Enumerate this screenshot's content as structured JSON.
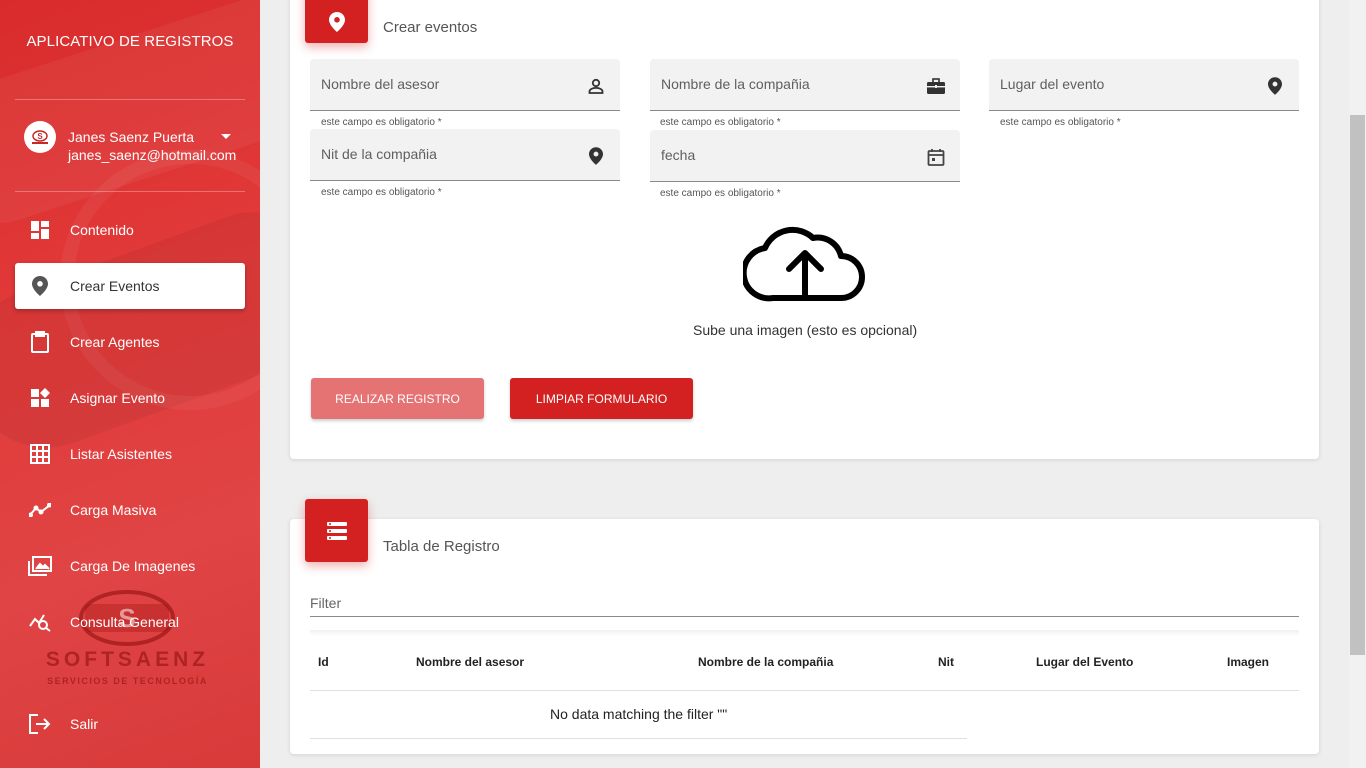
{
  "sidebar": {
    "brand_title": "APLICATIVO DE REGISTROS",
    "user": {
      "name": "Janes Saenz Puerta",
      "email": "janes_saenz@hotmail.com"
    },
    "items": [
      {
        "label": "Contenido",
        "icon": "dashboard-icon"
      },
      {
        "label": "Crear Eventos",
        "icon": "location-pin-icon",
        "active": true
      },
      {
        "label": "Crear Agentes",
        "icon": "clipboard-icon"
      },
      {
        "label": "Asignar Evento",
        "icon": "widgets-icon"
      },
      {
        "label": "Listar Asistentes",
        "icon": "grid-icon"
      },
      {
        "label": "Carga Masiva",
        "icon": "trend-line-icon"
      },
      {
        "label": "Carga De Imagenes",
        "icon": "photo-library-icon"
      },
      {
        "label": "Consulta General",
        "icon": "query-stats-icon"
      },
      {
        "label": "Salir",
        "icon": "logout-icon"
      }
    ],
    "logo": {
      "text": "SOFTSAENZ",
      "subtitle": "SERVICIOS DE TECNOLOGÍA"
    }
  },
  "form_card": {
    "title": "Crear eventos",
    "fields": {
      "asesor": {
        "label": "Nombre del asesor",
        "hint": "este campo es obligatorio *"
      },
      "compania": {
        "label": "Nombre de la compañia",
        "hint": "este campo es obligatorio *"
      },
      "lugar": {
        "label": "Lugar del evento",
        "hint": "este campo es obligatorio *"
      },
      "nit": {
        "label": "Nit de la compañia",
        "hint": "este campo es obligatorio *"
      },
      "fecha": {
        "label": "fecha",
        "hint": "este campo es obligatorio *"
      }
    },
    "upload_text": "Sube una imagen (esto es opcional)",
    "submit_label": "REALIZAR REGISTRO",
    "clear_label": "LIMPIAR FORMULARIO"
  },
  "table_card": {
    "title": "Tabla de Registro",
    "filter_placeholder": "Filter",
    "columns": [
      "Id",
      "Nombre del asesor",
      "Nombre de la compañia",
      "Nit",
      "Lugar del Evento",
      "Imagen"
    ],
    "empty_text": "No data matching the filter \"\""
  },
  "colors": {
    "accent": "#d32020",
    "accent_light": "#e57373",
    "sidebar": "#e03a3a"
  }
}
